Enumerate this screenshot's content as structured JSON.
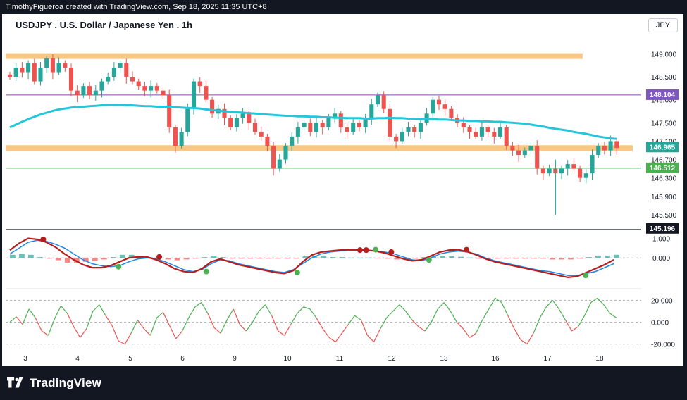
{
  "header": {
    "attribution": "TimothyFigueroa created with TradingView.com, Sep 18, 2025 11:35 UTC+8",
    "title": "USDJPY . U.S. Dollar / Japanese Yen . 1h",
    "currency": "JPY"
  },
  "footer": {
    "brand": "TradingView"
  },
  "colors": {
    "background": "#131722",
    "panel": "#ffffff",
    "up": "#26a69a",
    "down": "#ef5350",
    "ma": "#26c6da",
    "zone": "#f6c178",
    "resistance_line": "#8e44ad",
    "support_line": "#4caf50"
  },
  "chart_data": [
    {
      "type": "candlestick",
      "title": "USDJPY . U.S. Dollar / Japanese Yen . 1h",
      "x_ticks": [
        "3",
        "4",
        "5",
        "6",
        "9",
        "10",
        "11",
        "12",
        "13",
        "16",
        "17",
        "18"
      ],
      "y_ticks": [
        "149.000",
        "148.500",
        "148.000",
        "147.500",
        "147.100",
        "146.700",
        "146.300",
        "145.900",
        "145.500"
      ],
      "ylim": [
        145.3,
        149.45
      ],
      "price_labels": [
        {
          "label": "148.104",
          "value": 148.104,
          "color": "#7e57c2"
        },
        {
          "label": "146.965",
          "value": 146.965,
          "color": "#26a69a"
        },
        {
          "label": "146.512",
          "value": 146.512,
          "color": "#4caf50"
        },
        {
          "label": "145.196",
          "value": 145.196,
          "color": "#131722"
        }
      ],
      "zones": [
        {
          "value": 148.95,
          "x_start": 0,
          "x_end": 0.92
        },
        {
          "value": 146.95,
          "x_start": 0,
          "x_end": 1
        }
      ],
      "lines": [
        {
          "value": 148.104,
          "color": "#8e44ad"
        },
        {
          "value": 146.512,
          "color": "#4caf50"
        }
      ],
      "close_series": [
        148.5,
        148.7,
        148.6,
        148.8,
        148.4,
        148.7,
        148.9,
        148.6,
        148.8,
        148.7,
        148.2,
        148.1,
        148.3,
        148.1,
        148.2,
        148.4,
        148.5,
        148.7,
        148.8,
        148.5,
        148.4,
        148.3,
        148.2,
        148.3,
        148.2,
        148.1,
        147.4,
        147.0,
        147.3,
        147.8,
        148.4,
        148.3,
        148.0,
        147.7,
        147.8,
        147.6,
        147.4,
        147.6,
        147.7,
        147.5,
        147.3,
        147.2,
        147.0,
        146.5,
        146.7,
        147.0,
        147.2,
        147.4,
        147.5,
        147.3,
        147.5,
        147.4,
        147.6,
        147.7,
        147.4,
        147.3,
        147.5,
        147.4,
        147.6,
        147.9,
        148.1,
        147.8,
        147.2,
        147.1,
        147.3,
        147.4,
        147.3,
        147.5,
        147.7,
        148.0,
        147.9,
        147.8,
        147.6,
        147.5,
        147.4,
        147.3,
        147.2,
        147.4,
        147.3,
        147.2,
        147.4,
        147.0,
        146.9,
        146.8,
        146.9,
        147.0,
        146.5,
        146.4,
        146.5,
        146.4,
        146.5,
        146.6,
        146.5,
        146.3,
        146.4,
        146.8,
        147.0,
        146.9,
        147.1,
        146.95
      ],
      "ma_series": [
        147.4,
        147.46,
        147.52,
        147.58,
        147.63,
        147.68,
        147.72,
        147.76,
        147.79,
        147.81,
        147.83,
        147.84,
        147.85,
        147.86,
        147.87,
        147.88,
        147.89,
        147.89,
        147.89,
        147.88,
        147.88,
        147.87,
        147.86,
        147.86,
        147.85,
        147.85,
        147.85,
        147.84,
        147.83,
        147.82,
        147.82,
        147.81,
        147.79,
        147.78,
        147.76,
        147.75,
        147.74,
        147.73,
        147.72,
        147.71,
        147.7,
        147.69,
        147.68,
        147.67,
        147.66,
        147.65,
        147.65,
        147.64,
        147.64,
        147.63,
        147.63,
        147.62,
        147.62,
        147.61,
        147.61,
        147.6,
        147.6,
        147.6,
        147.59,
        147.59,
        147.6,
        147.6,
        147.61,
        147.6,
        147.6,
        147.59,
        147.59,
        147.58,
        147.58,
        147.58,
        147.57,
        147.57,
        147.56,
        147.55,
        147.55,
        147.54,
        147.54,
        147.53,
        147.53,
        147.52,
        147.52,
        147.51,
        147.5,
        147.49,
        147.48,
        147.46,
        147.44,
        147.42,
        147.39,
        147.37,
        147.35,
        147.33,
        147.3,
        147.28,
        147.26,
        147.23,
        147.2,
        147.18,
        147.16,
        147.15
      ]
    },
    {
      "type": "line",
      "title": "",
      "y_ticks": [
        "1.000",
        "0.000"
      ],
      "ylim": [
        -1.4,
        1.2
      ],
      "series": [
        {
          "color": "#1e88e5",
          "values": [
            0.2,
            0.5,
            0.8,
            0.9,
            0.85,
            0.7,
            0.5,
            0.2,
            -0.1,
            -0.3,
            -0.4,
            -0.45,
            -0.4,
            -0.2,
            -0.05,
            0.0,
            -0.05,
            -0.2,
            -0.4,
            -0.6,
            -0.7,
            -0.6,
            -0.3,
            -0.1,
            -0.15,
            -0.3,
            -0.4,
            -0.5,
            -0.6,
            -0.7,
            -0.75,
            -0.6,
            -0.3,
            0.0,
            0.2,
            0.3,
            0.35,
            0.4,
            0.4,
            0.38,
            0.36,
            0.3,
            0.2,
            0.05,
            -0.1,
            -0.15,
            0.0,
            0.2,
            0.3,
            0.35,
            0.3,
            0.2,
            0.0,
            -0.15,
            -0.25,
            -0.35,
            -0.45,
            -0.55,
            -0.65,
            -0.7,
            -0.8,
            -0.9,
            -0.9,
            -0.8,
            -0.7,
            -0.5,
            -0.3
          ]
        },
        {
          "color": "#b71c1c",
          "values": [
            0.4,
            0.75,
            1.0,
            0.95,
            0.8,
            0.55,
            0.2,
            -0.1,
            -0.35,
            -0.5,
            -0.5,
            -0.4,
            -0.2,
            0.0,
            0.05,
            0.05,
            -0.1,
            -0.3,
            -0.55,
            -0.7,
            -0.75,
            -0.55,
            -0.2,
            -0.05,
            -0.2,
            -0.35,
            -0.45,
            -0.55,
            -0.65,
            -0.75,
            -0.8,
            -0.65,
            -0.2,
            0.15,
            0.3,
            0.35,
            0.4,
            0.42,
            0.42,
            0.4,
            0.35,
            0.25,
            0.1,
            -0.05,
            -0.15,
            -0.1,
            0.1,
            0.3,
            0.4,
            0.42,
            0.32,
            0.15,
            -0.05,
            -0.2,
            -0.3,
            -0.4,
            -0.5,
            -0.6,
            -0.7,
            -0.8,
            -0.9,
            -1.0,
            -0.95,
            -0.75,
            -0.55,
            -0.35,
            -0.1
          ]
        }
      ],
      "cross_markers": [
        {
          "x": 0.06,
          "y": 0.95,
          "color": "#b71c1c"
        },
        {
          "x": 0.18,
          "y": -0.45,
          "color": "#4caf50"
        },
        {
          "x": 0.245,
          "y": 0.05,
          "color": "#b71c1c"
        },
        {
          "x": 0.32,
          "y": -0.7,
          "color": "#4caf50"
        },
        {
          "x": 0.465,
          "y": -0.75,
          "color": "#4caf50"
        },
        {
          "x": 0.565,
          "y": 0.4,
          "color": "#b71c1c"
        },
        {
          "x": 0.575,
          "y": 0.4,
          "color": "#b71c1c"
        },
        {
          "x": 0.59,
          "y": 0.42,
          "color": "#4caf50"
        },
        {
          "x": 0.615,
          "y": 0.3,
          "color": "#b71c1c"
        },
        {
          "x": 0.675,
          "y": -0.1,
          "color": "#4caf50"
        },
        {
          "x": 0.735,
          "y": 0.42,
          "color": "#b71c1c"
        },
        {
          "x": 0.925,
          "y": -0.9,
          "color": "#4caf50"
        }
      ]
    },
    {
      "type": "line",
      "title": "",
      "y_ticks": [
        "20.000",
        "0.000",
        "-20.000"
      ],
      "ylim": [
        -26,
        28
      ],
      "series": [
        {
          "color": "#4caf50",
          "values": [
            0,
            5,
            -2,
            12,
            4,
            -8,
            -12,
            3,
            15,
            8,
            -4,
            -14,
            -6,
            10,
            16,
            6,
            -3,
            -17,
            -20,
            -10,
            2,
            -6,
            -12,
            4,
            9,
            -3,
            -15,
            -8,
            4,
            14,
            18,
            8,
            -5,
            -10,
            2,
            12,
            -2,
            -8,
            0,
            10,
            16,
            6,
            -8,
            -12,
            -2,
            8,
            14,
            12,
            4,
            -6,
            -14,
            -18,
            -10,
            -2,
            6,
            2,
            -12,
            -18,
            -6,
            4,
            10,
            16,
            10,
            2,
            -4,
            -8,
            0,
            12,
            18,
            10,
            0,
            -6,
            -14,
            -10,
            2,
            12,
            22,
            18,
            6,
            -6,
            -16,
            -20,
            -10,
            4,
            14,
            20,
            12,
            2,
            -8,
            -4,
            6,
            18,
            22,
            16,
            8,
            4
          ]
        }
      ]
    }
  ]
}
